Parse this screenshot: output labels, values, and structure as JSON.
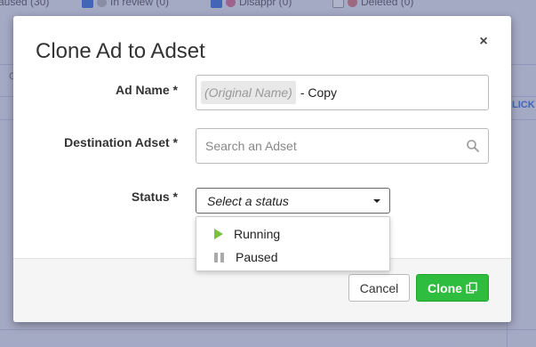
{
  "background": {
    "filters": [
      {
        "label": "aused (30)",
        "checked": false
      },
      {
        "label": "In review (0)",
        "checked": true
      },
      {
        "label": "Disappr (0)",
        "checked": true
      },
      {
        "label": "Deleted (0)",
        "checked": false
      }
    ],
    "left_column_text": "C",
    "right_column_text": "LICK"
  },
  "modal": {
    "title": "Clone Ad to Adset",
    "close_label": "×",
    "fields": {
      "ad_name": {
        "label": "Ad Name *",
        "original_name_token": "(Original Name)",
        "suffix": "- Copy"
      },
      "destination": {
        "label": "Destination Adset *",
        "placeholder": "Search an Adset",
        "value": ""
      },
      "status": {
        "label": "Status *",
        "selected": "Select a status",
        "options": [
          {
            "label": "Running",
            "icon": "play-icon",
            "color": "#7ac142"
          },
          {
            "label": "Paused",
            "icon": "pause-icon",
            "color": "#aaaaaa"
          }
        ]
      }
    },
    "buttons": {
      "cancel": "Cancel",
      "clone": "Clone"
    }
  },
  "colors": {
    "accent_green": "#2ebd3e",
    "overlay": "#50588c"
  }
}
